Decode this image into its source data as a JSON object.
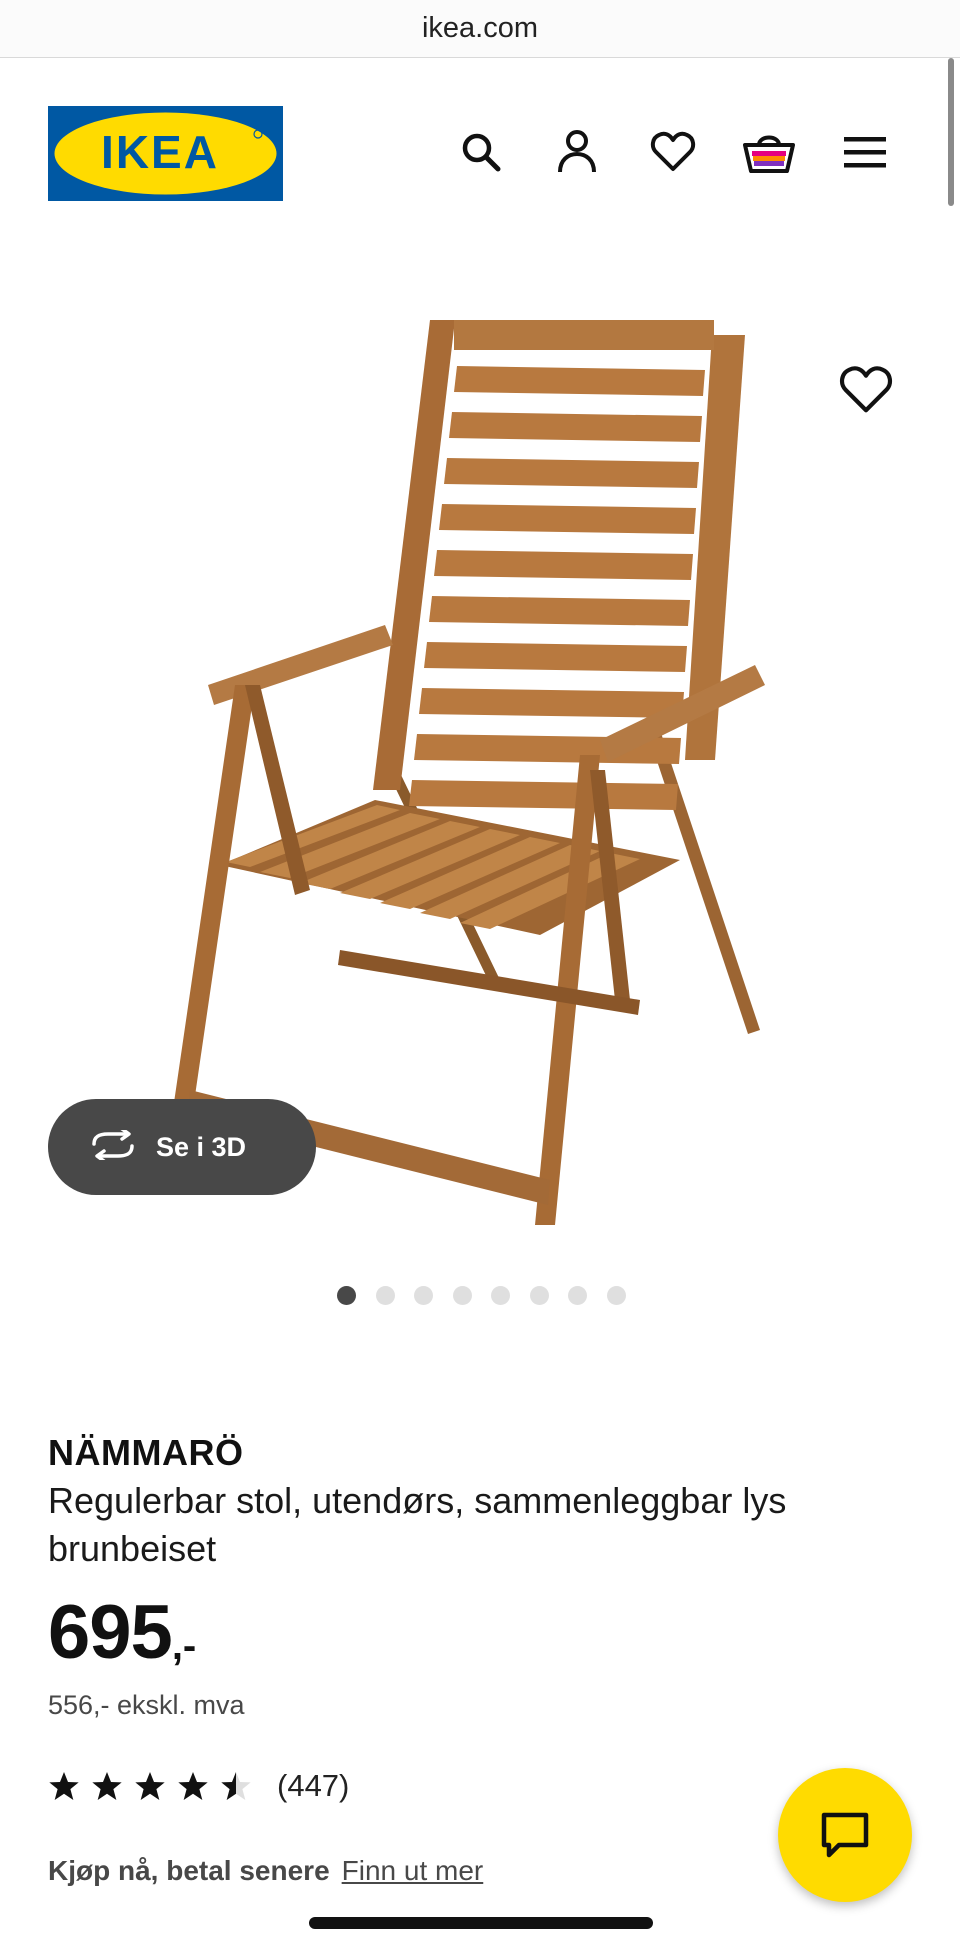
{
  "browser": {
    "url": "ikea.com"
  },
  "header": {
    "logo_text": "IKEA",
    "icons": [
      "search-icon",
      "profile-icon",
      "favorites-icon",
      "cart-icon",
      "menu-icon"
    ]
  },
  "gallery": {
    "view_3d_label": "Se i 3D",
    "total_images": 8,
    "active_index": 0
  },
  "product": {
    "name": "NÄMMARÖ",
    "description": "Regulerbar stol, utendørs, sammenleggbar lys brunbeiset",
    "price_integer": "695",
    "price_suffix": ",-",
    "price_ex_vat": "556,- ekskl. mva",
    "rating_value": 4.5,
    "rating_max": 5,
    "review_count": "(447)"
  },
  "finance": {
    "text": "Kjøp nå, betal senere",
    "link": "Finn ut mer"
  },
  "colors": {
    "ikea_blue": "#0058a3",
    "ikea_yellow": "#ffdb00",
    "pill_gray": "#484848"
  }
}
